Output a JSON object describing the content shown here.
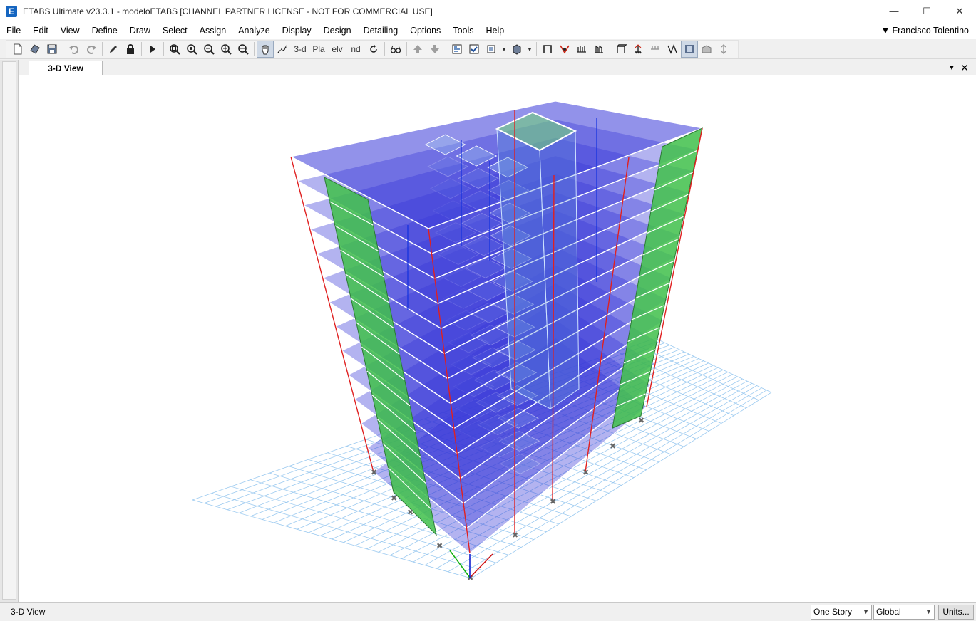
{
  "window": {
    "title": "ETABS Ultimate v23.3.1 - modeloETABS  [CHANNEL PARTNER LICENSE - NOT FOR COMMERCIAL USE]",
    "app_icon_letter": "E",
    "minimize": "—",
    "maximize": "☐",
    "close": "✕"
  },
  "menu": {
    "items": [
      "File",
      "Edit",
      "View",
      "Define",
      "Draw",
      "Select",
      "Assign",
      "Analyze",
      "Display",
      "Design",
      "Detailing",
      "Options",
      "Tools",
      "Help"
    ],
    "user": "▼ Francisco Tolentino"
  },
  "toolbar": {
    "view_3d_label": "3-d",
    "plan_label": "Pla",
    "elevation_label": "elv",
    "nd_label": "nd"
  },
  "tab": {
    "label": "3-D View",
    "menu_glyph": "▼",
    "close_glyph": "✕"
  },
  "status": {
    "view_name": "3-D View",
    "story_option": "One Story",
    "coord_system": "Global",
    "units_button": "Units..."
  },
  "colors": {
    "slab": "#3838d8",
    "wall": "#3fbf4a",
    "column": "#e02020",
    "grid": "#9ccaf0"
  }
}
